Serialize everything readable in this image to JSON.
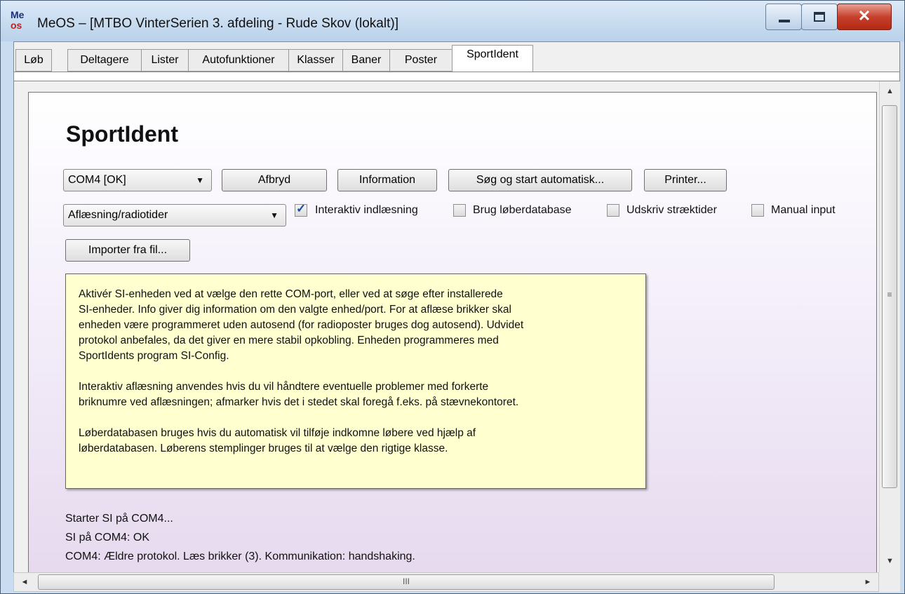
{
  "window": {
    "title": "MeOS – [MTBO VinterSerien 3. afdeling - Rude Skov (lokalt)]",
    "icon_text_top": "Me",
    "icon_text_bottom": "os"
  },
  "tabs": [
    {
      "label": "Løb"
    },
    {
      "label": "Deltagere"
    },
    {
      "label": "Lister"
    },
    {
      "label": "Autofunktioner"
    },
    {
      "label": "Klasser"
    },
    {
      "label": "Baner"
    },
    {
      "label": "Poster"
    },
    {
      "label": "SportIdent",
      "active": true
    }
  ],
  "page": {
    "heading": "SportIdent",
    "port_combo": {
      "value": "COM4 [OK]"
    },
    "mode_combo": {
      "value": "Aflæsning/radiotider"
    },
    "buttons": {
      "disconnect": "Afbryd",
      "information": "Information",
      "auto_search": "Søg og start automatisk...",
      "printer": "Printer...",
      "import": "Importer fra fil..."
    },
    "checkboxes": [
      {
        "label": "Interaktiv indlæsning",
        "checked": true
      },
      {
        "label": "Brug løberdatabase",
        "checked": false
      },
      {
        "label": "Udskriv stræktider",
        "checked": false
      },
      {
        "label": "Manual input",
        "checked": false
      }
    ],
    "info_lines": [
      "Aktivér SI-enheden ved at vælge den rette COM-port, eller ved at søge efter installerede",
      "SI-enheder. Info giver dig information om den valgte enhed/port. For at aflæse brikker skal",
      "enheden være programmeret uden autosend (for radioposter bruges dog autosend). Udvidet",
      "protokol anbefales, da det giver en mere stabil opkobling. Enheden programmeres med",
      "SportIdents program SI-Config.",
      "Interaktiv aflæsning anvendes hvis du vil håndtere eventuelle problemer med forkerte",
      "briknumre ved aflæsningen; afmarker hvis det i stedet skal foregå f.eks. på stævnekontoret.",
      "Løberdatabasen bruges hvis du automatisk vil tilføje indkomne løbere ved hjælp af",
      "løberdatabasen. Løberens stemplinger bruges til at vælge den rigtige klasse."
    ],
    "log": [
      "Starter SI på COM4...",
      "SI på COM4: OK",
      "COM4: Ældre protokol. Læs brikker (3). Kommunikation: handshaking."
    ]
  },
  "icons": {
    "minimize": "minimize-icon",
    "maximize": "maximize-icon",
    "close": "close-icon",
    "dropdown": "chevron-down-icon",
    "scroll_up": "arrow-up-icon",
    "scroll_down": "arrow-down-icon",
    "scroll_left": "arrow-left-icon",
    "scroll_right": "arrow-right-icon",
    "check": "checkmark-icon"
  },
  "glyphs": {
    "caret": "▼",
    "check": "✓",
    "close": "✕",
    "up": "▲",
    "down": "▼",
    "left": "◄",
    "right": "►",
    "vgrip": "≡",
    "hgrip": "III",
    "sizegrip": "⋰"
  }
}
